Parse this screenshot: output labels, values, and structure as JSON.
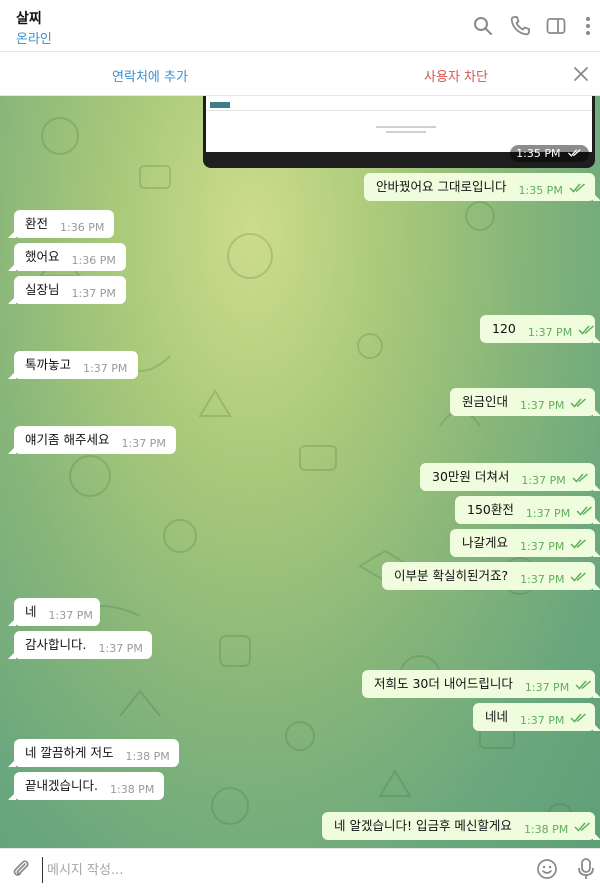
{
  "header": {
    "name": "살찌",
    "status": "온라인"
  },
  "action_bar": {
    "add_contact": "연락처에 추가",
    "block_user": "사용자 차단"
  },
  "preview": {
    "time": "1:35 PM"
  },
  "messages": [
    {
      "text": "안바꿨어요 그대로입니다",
      "time": "1:35 PM",
      "dir": "out"
    },
    {
      "text": "환전",
      "time": "1:36 PM",
      "dir": "in"
    },
    {
      "text": "했어요",
      "time": "1:36 PM",
      "dir": "in"
    },
    {
      "text": "실장님",
      "time": "1:37 PM",
      "dir": "in"
    },
    {
      "text": "120",
      "time": "1:37 PM",
      "dir": "out"
    },
    {
      "text": "톡까놓고",
      "time": "1:37 PM",
      "dir": "in"
    },
    {
      "text": "원금인대",
      "time": "1:37 PM",
      "dir": "out"
    },
    {
      "text": "얘기좀 해주세요",
      "time": "1:37 PM",
      "dir": "in"
    },
    {
      "text": "30만원 더쳐서",
      "time": "1:37 PM",
      "dir": "out"
    },
    {
      "text": "150환전",
      "time": "1:37 PM",
      "dir": "out"
    },
    {
      "text": "나갈게요",
      "time": "1:37 PM",
      "dir": "out"
    },
    {
      "text": "이부분 확실히된거죠?",
      "time": "1:37 PM",
      "dir": "out"
    },
    {
      "text": "네",
      "time": "1:37 PM",
      "dir": "in"
    },
    {
      "text": "감사합니다.",
      "time": "1:37 PM",
      "dir": "in"
    },
    {
      "text": "저희도 30더 내어드립니다",
      "time": "1:37 PM",
      "dir": "out"
    },
    {
      "text": "네네",
      "time": "1:37 PM",
      "dir": "out"
    },
    {
      "text": "네 깔끔하게 저도",
      "time": "1:38 PM",
      "dir": "in"
    },
    {
      "text": "끝내겠습니다.",
      "time": "1:38 PM",
      "dir": "in"
    },
    {
      "text": "네 알겠습니다! 입금후 메신할게요",
      "time": "1:38 PM",
      "dir": "out"
    }
  ],
  "composer": {
    "placeholder": "메시지 작성..."
  },
  "icons": [
    "search-icon",
    "phone-icon",
    "sidebar-icon",
    "more-icon",
    "close-icon",
    "attach-icon",
    "emoji-icon",
    "mic-icon",
    "double-check-icon"
  ],
  "colors": {
    "accent": "#3a8fd0",
    "danger": "#d9534f",
    "outgoing_bubble": "#effdde",
    "read_ticks": "#5fae5a"
  }
}
